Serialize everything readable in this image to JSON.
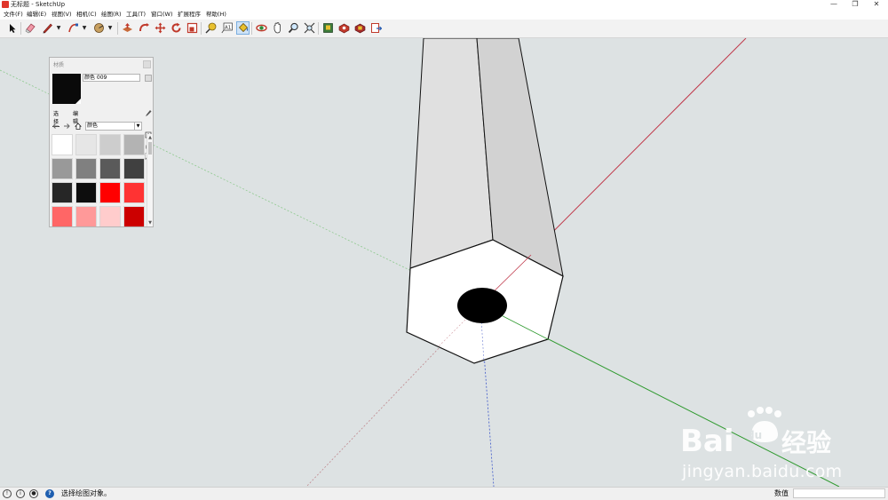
{
  "window": {
    "title": "无标题 - SketchUp",
    "minimize_glyph": "—",
    "restore_glyph": "❐",
    "close_glyph": "✕"
  },
  "menu": [
    {
      "label": "文件(F)"
    },
    {
      "label": "编辑(E)"
    },
    {
      "label": "视图(V)"
    },
    {
      "label": "相机(C)"
    },
    {
      "label": "绘图(R)"
    },
    {
      "label": "工具(T)"
    },
    {
      "label": "窗口(W)"
    },
    {
      "label": "扩展程序"
    },
    {
      "label": "帮助(H)"
    }
  ],
  "toolbar": {
    "icons": [
      "select-icon",
      "eraser-icon",
      "pencil-line-icon",
      "arc-icon",
      "shape-icon",
      "push-pull-icon",
      "follow-me-icon",
      "move-icon",
      "rotate-icon",
      "scale-icon",
      "tape-measure-icon",
      "text-icon",
      "paint-bucket-icon",
      "orbit-icon",
      "pan-icon",
      "zoom-icon",
      "zoom-extents-icon",
      "warehouse-icon",
      "extension-warehouse-icon",
      "components-icon",
      "send-layout-icon"
    ],
    "active_tool": "paint-bucket-icon"
  },
  "materials_panel": {
    "title": "材质",
    "material_name": "颜色 009",
    "tabs": [
      {
        "label": "选择",
        "selected": true
      },
      {
        "label": "编辑",
        "selected": false
      }
    ],
    "library": "颜色",
    "preview_color": "#0a0a0a",
    "swatches": [
      "#ffffff",
      "#e6e6e6",
      "#cdcdcd",
      "#b3b3b3",
      "#999999",
      "#808080",
      "#5a5a5a",
      "#404040",
      "#262626",
      "#0d0d0d",
      "#ff0000",
      "#ff3333",
      "#ff6666",
      "#ff9999",
      "#ffcccc",
      "#cc0000"
    ]
  },
  "statusbar": {
    "message": "选择绘图对象。",
    "value_label": "数值",
    "value": ""
  },
  "watermark": {
    "text": "jingyan.baidu.com"
  },
  "colors": {
    "viewport_bg": "#dde2e3",
    "red_axis": "#c0384a",
    "green_axis": "#2f9a2f",
    "blue_axis": "#3a55c9",
    "active_tool_bg": "#cfe3f7"
  }
}
